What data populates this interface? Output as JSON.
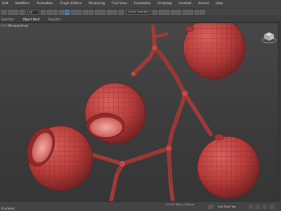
{
  "menubar": {
    "items": [
      "Edit",
      "Modifiers",
      "Animation",
      "Graph Editors",
      "Rendering",
      "Civil View",
      "Customize",
      "Scripting",
      "Content",
      "Arnold",
      "Help"
    ]
  },
  "toolbar": {
    "selection_filter": "All",
    "named_selection_placeholder": "Create Selection Set"
  },
  "ribbon": {
    "tabs": [
      "Selection",
      "Object Paint",
      "Populate"
    ],
    "active_tab": "Object Paint"
  },
  "viewport": {
    "label": "[+] [Perspective]",
    "bottom_label": "",
    "colors": {
      "object": "#b8413f",
      "wire": "#7a1d1f",
      "background": "#404040"
    }
  },
  "statusbar": {
    "prompt": "Academic",
    "coords": "X: Y: Z: Grid = 10.0cm",
    "add_time_tag": "Add Time Tag"
  }
}
